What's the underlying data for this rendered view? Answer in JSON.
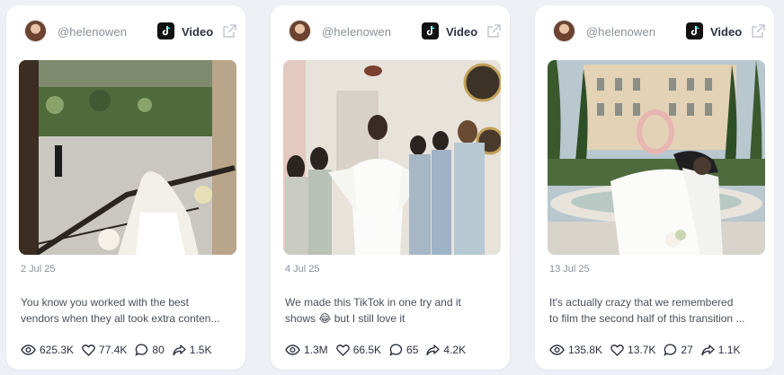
{
  "cards": [
    {
      "username": "@helenowen",
      "type_label": "Video",
      "date": "2 Jul 25",
      "caption_line1": "You know you worked with the best",
      "caption_line2": "vendors when they all took extra conten...",
      "views": "625.3K",
      "likes": "77.4K",
      "comments": "80",
      "shares": "1.5K"
    },
    {
      "username": "@helenowen",
      "type_label": "Video",
      "date": "4 Jul 25",
      "caption_line1": "We made this TikTok in one try and it",
      "caption_line2_a": "shows",
      "caption_emoji": "😂",
      "caption_line2_b": "but I still love it",
      "views": "1.3M",
      "likes": "66.5K",
      "comments": "65",
      "shares": "4.2K"
    },
    {
      "username": "@helenowen",
      "type_label": "Video",
      "date": "13 Jul 25",
      "caption_line1": "It's actually crazy that we remembered",
      "caption_line2": "to film the second half of this transition ...",
      "views": "135.8K",
      "likes": "13.7K",
      "comments": "27",
      "shares": "1.1K"
    }
  ],
  "icons": {
    "platform": "tiktok-icon",
    "open": "external-link-icon",
    "views": "eye-icon",
    "likes": "heart-icon",
    "comments": "comment-icon",
    "shares": "share-icon"
  },
  "colors": {
    "background": "#eef0f6",
    "card": "#ffffff",
    "muted_text": "#8a8e9a",
    "dark_text": "#2d3142"
  }
}
